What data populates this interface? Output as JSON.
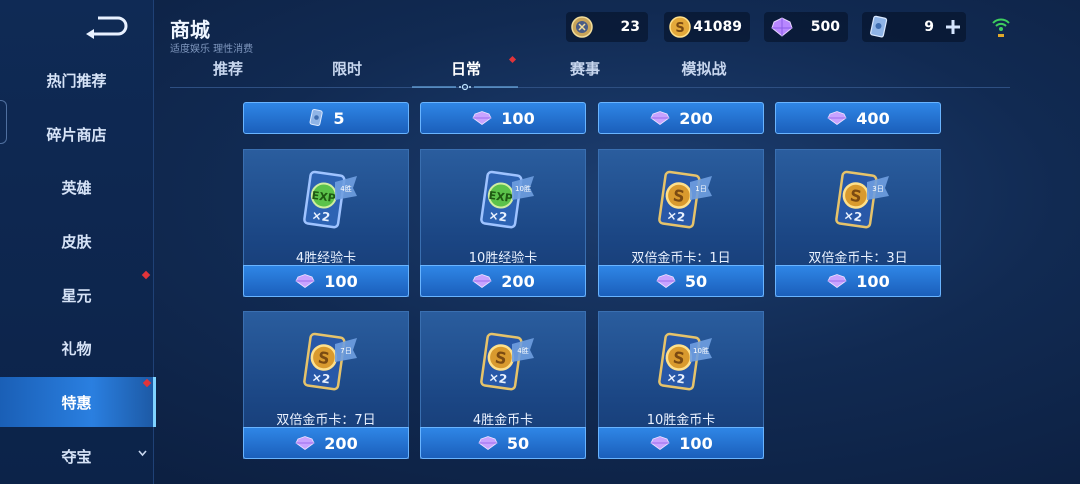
{
  "sidebar": {
    "items": [
      {
        "label": "热门推荐"
      },
      {
        "label": "碎片商店"
      },
      {
        "label": "英雄"
      },
      {
        "label": "皮肤"
      },
      {
        "label": "星元"
      },
      {
        "label": "礼物"
      },
      {
        "label": "特惠"
      },
      {
        "label": "夺宝"
      }
    ],
    "active_label": "特惠"
  },
  "header": {
    "title": "商城",
    "subtitle": "适度娱乐 理性消费"
  },
  "resources": [
    {
      "icon": "medal-coin-icon",
      "value": "23"
    },
    {
      "icon": "gold-coin-icon",
      "value": "41089"
    },
    {
      "icon": "diamond-icon",
      "value": "500"
    },
    {
      "icon": "card-ticket-icon",
      "value": "9"
    }
  ],
  "tabs": [
    {
      "label": "推荐"
    },
    {
      "label": "限时"
    },
    {
      "label": "日常"
    },
    {
      "label": "赛事"
    },
    {
      "label": "模拟战"
    }
  ],
  "active_tab": "日常",
  "top_row_prices": [
    {
      "icon": "card-ticket-icon",
      "price": "5"
    },
    {
      "icon": "diamond-icon",
      "price": "100"
    },
    {
      "icon": "diamond-icon",
      "price": "200"
    },
    {
      "icon": "diamond-icon",
      "price": "400"
    }
  ],
  "items": [
    {
      "name": "4胜经验卡",
      "price": "100",
      "art": "exp-card-icon",
      "tag": "4胜"
    },
    {
      "name": "10胜经验卡",
      "price": "200",
      "art": "exp-card-icon",
      "tag": "10胜"
    },
    {
      "name": "双倍金币卡：1日",
      "price": "50",
      "art": "gold-card-icon",
      "tag": "1日"
    },
    {
      "name": "双倍金币卡：3日",
      "price": "100",
      "art": "gold-card-icon",
      "tag": "3日"
    },
    {
      "name": "双倍金币卡：7日",
      "price": "200",
      "art": "gold-card-icon",
      "tag": "7日"
    },
    {
      "name": "4胜金币卡",
      "price": "50",
      "art": "gold-card-icon",
      "tag": "4胜"
    },
    {
      "name": "10胜金币卡",
      "price": "100",
      "art": "gold-card-icon",
      "tag": "10胜"
    }
  ],
  "colors": {
    "accent": "#2f86e6",
    "active_side": "#2a7fe0",
    "badge_red": "#e0343a",
    "gem_purple": "#b887ff"
  }
}
